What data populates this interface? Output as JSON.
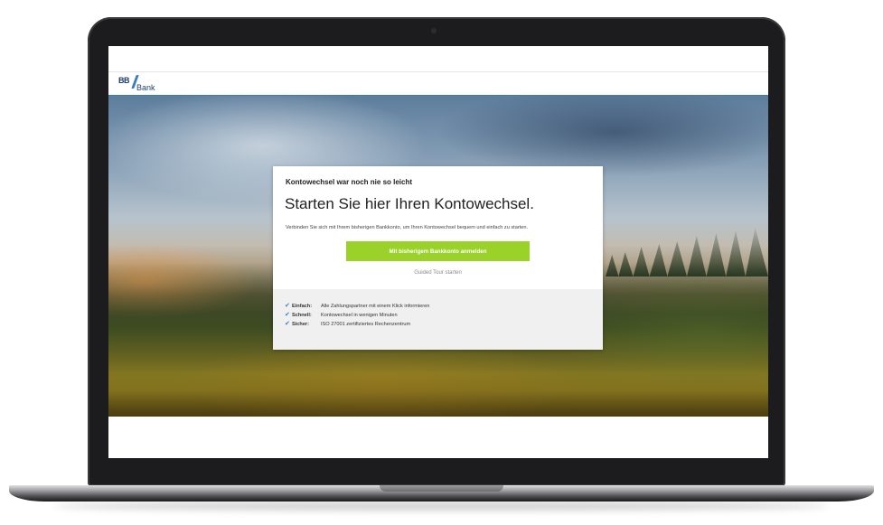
{
  "header": {
    "logo_bb": "BB",
    "logo_bank": "Bank"
  },
  "card": {
    "eyebrow": "Kontowechsel war noch nie so leicht",
    "title": "Starten Sie hier Ihren Kontowechsel.",
    "description": "Verbinden Sie sich mit Ihrem bisherigen Bankkonto, um Ihren Kontowechsel bequem und einfach zu starten.",
    "cta_label": "Mit bisherigem Bankkonto anmelden",
    "tour_link": "Guided Tour starten",
    "features": [
      {
        "label": "Einfach:",
        "text": "Alle Zahlungspartner mit einem Klick informieren"
      },
      {
        "label": "Schnell:",
        "text": "Kontowechsel in wenigen Minuten"
      },
      {
        "label": "Sicher:",
        "text": "ISO 27001 zertifiziertes Rechenzentrum"
      }
    ]
  },
  "icons": {
    "check": "check-icon",
    "logo_slash": "logo-slash-icon"
  },
  "colors": {
    "accent_green": "#9bd22a",
    "brand_blue": "#3a7dc4",
    "brand_navy": "#1f3e70"
  }
}
